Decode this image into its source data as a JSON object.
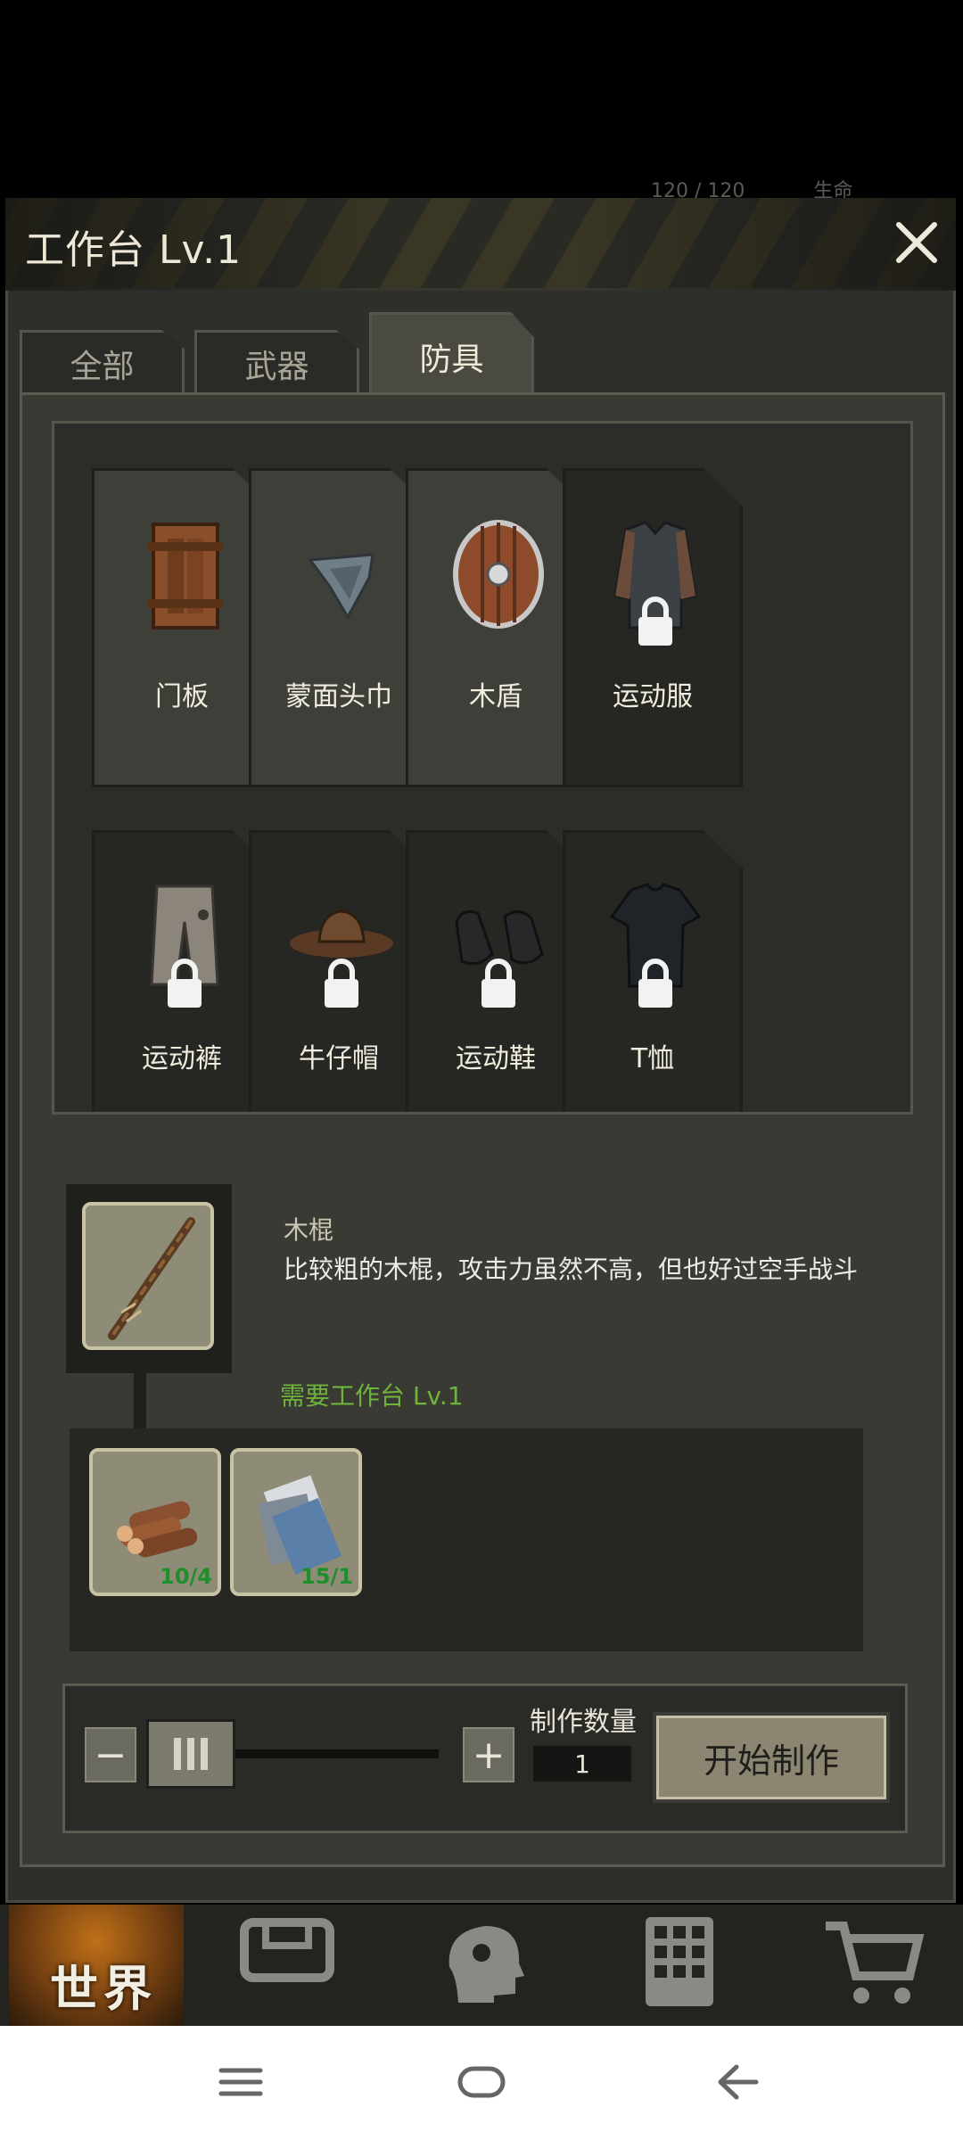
{
  "top_hint": {
    "count": "120 / 120",
    "label": "生命"
  },
  "title": "工作台 Lv.1",
  "tabs": [
    {
      "label": "全部",
      "active": false
    },
    {
      "label": "武器",
      "active": false
    },
    {
      "label": "防具",
      "active": true
    }
  ],
  "items": [
    {
      "label": "门板",
      "icon": "door-board-icon",
      "locked": false
    },
    {
      "label": "蒙面头巾",
      "icon": "bandana-icon",
      "locked": false
    },
    {
      "label": "木盾",
      "icon": "wooden-shield-icon",
      "locked": false
    },
    {
      "label": "运动服",
      "icon": "sports-jacket-icon",
      "locked": true
    },
    {
      "label": "运动裤",
      "icon": "sports-pants-icon",
      "locked": true
    },
    {
      "label": "牛仔帽",
      "icon": "cowboy-hat-icon",
      "locked": true
    },
    {
      "label": "运动鞋",
      "icon": "sneakers-icon",
      "locked": true
    },
    {
      "label": "T恤",
      "icon": "tshirt-icon",
      "locked": true
    }
  ],
  "recipe": {
    "name": "木棍",
    "description": "比较粗的木棍，攻击力虽然不高，但也好过空手战斗",
    "requirement": "需要工作台 Lv.1",
    "materials": [
      {
        "icon": "wood-logs-icon",
        "count": "10/4"
      },
      {
        "icon": "cloth-scraps-icon",
        "count": "15/1"
      }
    ]
  },
  "craft": {
    "minus": "−",
    "plus": "+",
    "qty_label": "制作数量",
    "qty_value": "1",
    "start_label": "开始制作"
  },
  "nav": {
    "world_label": "世界"
  },
  "colors": {
    "requirement_green": "#6fb33d",
    "count_green": "#1e8f2b",
    "panel": "#2e2e2a"
  }
}
